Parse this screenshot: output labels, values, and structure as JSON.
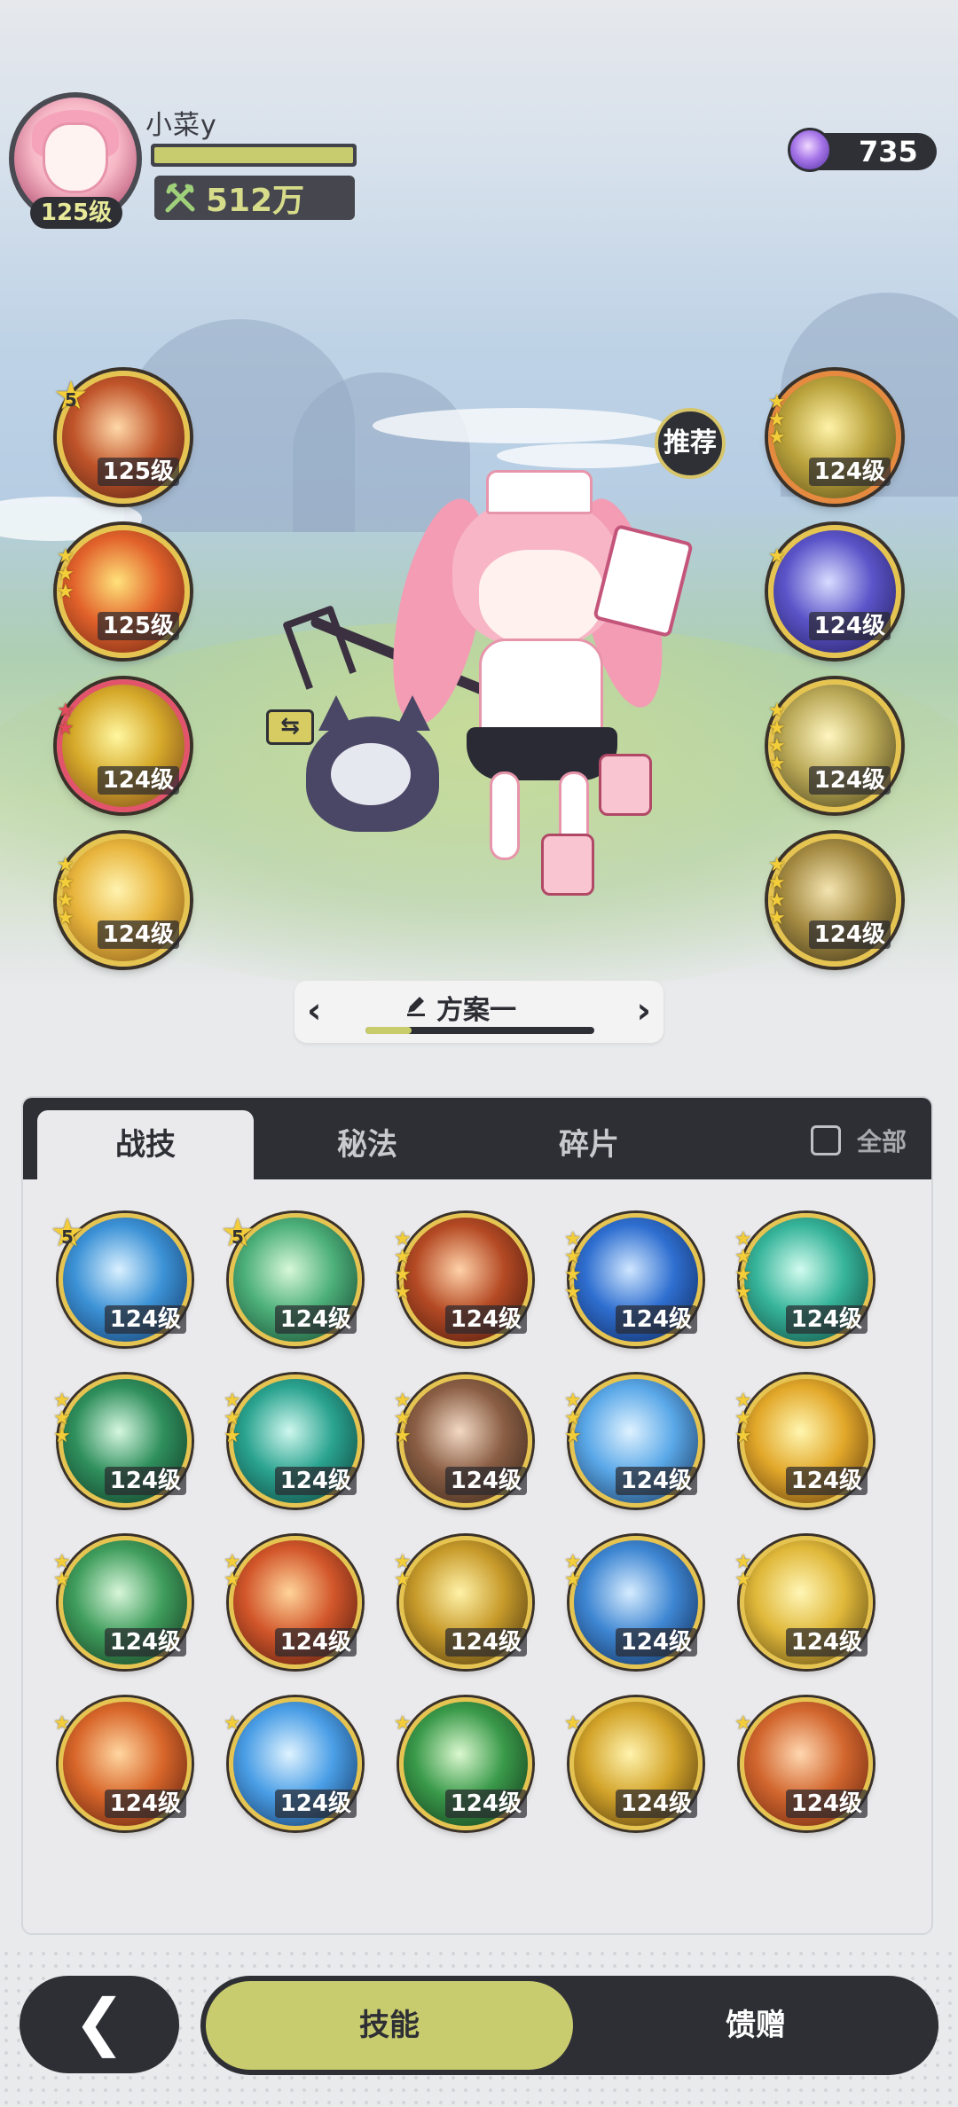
{
  "player": {
    "name": "小菜y",
    "level": "125级",
    "power": "512万",
    "exp_fraction": 1.0
  },
  "currency": {
    "icon": "purple-crystal-icon",
    "value": "735"
  },
  "recommend_label": "推荐",
  "left_slots": [
    {
      "level": "125级",
      "badge": "5",
      "stars": 0,
      "ring": "gold",
      "colors": [
        "#ffd8a8",
        "#c0542a",
        "#4a1d12"
      ]
    },
    {
      "level": "125级",
      "stars": 3,
      "ring": "gold",
      "colors": [
        "#ffe27a",
        "#e2622b",
        "#5e1e12"
      ]
    },
    {
      "level": "124级",
      "stars": 2,
      "star_color": "red",
      "ring": "red",
      "colors": [
        "#fff7a0",
        "#d6a92a",
        "#6b3a1a"
      ]
    },
    {
      "level": "124级",
      "stars": 4,
      "ring": "gold",
      "colors": [
        "#fff3b0",
        "#e8b53d",
        "#7a4f16"
      ]
    }
  ],
  "right_slots": [
    {
      "level": "124级",
      "stars": 3,
      "ring": "orange",
      "colors": [
        "#fff3a8",
        "#b9a23c",
        "#4f4416"
      ]
    },
    {
      "level": "124级",
      "stars": 1,
      "ring": "gold",
      "colors": [
        "#d8dcff",
        "#5b54c9",
        "#1d1850"
      ]
    },
    {
      "level": "124级",
      "stars": 4,
      "ring": "gold",
      "colors": [
        "#fff6c0",
        "#b9a857",
        "#3d3614"
      ]
    },
    {
      "level": "124级",
      "stars": 4,
      "ring": "gold",
      "colors": [
        "#f3e4b0",
        "#a48a42",
        "#2f2814"
      ]
    }
  ],
  "swap_label": "⇆",
  "preset": {
    "title": "方案一",
    "progress": 0.2
  },
  "panel": {
    "tabs": [
      "战技",
      "秘法",
      "碎片"
    ],
    "active_tab": 0,
    "check_all_label": "全部"
  },
  "skills": [
    {
      "level": "124级",
      "badge": "5",
      "stars": 0,
      "colors": [
        "#d9f0ff",
        "#3c92d6",
        "#0f2f5a"
      ]
    },
    {
      "level": "124级",
      "badge": "5",
      "stars": 0,
      "colors": [
        "#d7f7d9",
        "#4db07a",
        "#0f3a26"
      ]
    },
    {
      "level": "124级",
      "stars": 4,
      "colors": [
        "#ffd1a8",
        "#b44a24",
        "#3a120c"
      ]
    },
    {
      "level": "124级",
      "stars": 4,
      "colors": [
        "#cfe6ff",
        "#2f6fd0",
        "#0b1f4e"
      ]
    },
    {
      "level": "124级",
      "stars": 4,
      "colors": [
        "#d2fbee",
        "#36b49a",
        "#0c3b33"
      ]
    },
    {
      "level": "124级",
      "stars": 3,
      "colors": [
        "#d6f7e0",
        "#2f8f5c",
        "#0c2d1f"
      ]
    },
    {
      "level": "124级",
      "stars": 3,
      "colors": [
        "#cff7ee",
        "#2aa38f",
        "#0a3430"
      ]
    },
    {
      "level": "124级",
      "stars": 3,
      "colors": [
        "#f3d9c4",
        "#8a5e44",
        "#2f1f16"
      ]
    },
    {
      "level": "124级",
      "stars": 3,
      "colors": [
        "#dff2ff",
        "#5aa8e8",
        "#10284a"
      ]
    },
    {
      "level": "124级",
      "stars": 3,
      "colors": [
        "#fff6b0",
        "#e2a82a",
        "#4f2c0c"
      ]
    },
    {
      "level": "124级",
      "stars": 2,
      "colors": [
        "#d8f6da",
        "#3f9d5c",
        "#0f2c19"
      ]
    },
    {
      "level": "124级",
      "stars": 2,
      "colors": [
        "#ffd49a",
        "#d2562a",
        "#3e120c"
      ]
    },
    {
      "level": "124级",
      "stars": 2,
      "colors": [
        "#fff2a8",
        "#c79a2a",
        "#3a2a0c"
      ]
    },
    {
      "level": "124级",
      "stars": 2,
      "colors": [
        "#d6ecff",
        "#3e86d2",
        "#0c2146"
      ]
    },
    {
      "level": "124级",
      "stars": 2,
      "colors": [
        "#fff6b6",
        "#e0b83a",
        "#4a380e"
      ]
    },
    {
      "level": "124级",
      "stars": 1,
      "colors": [
        "#ffd6a0",
        "#d8662a",
        "#4a160c"
      ]
    },
    {
      "level": "124级",
      "stars": 1,
      "colors": [
        "#dff3ff",
        "#4a9ee6",
        "#0e2a52"
      ]
    },
    {
      "level": "124级",
      "stars": 1,
      "colors": [
        "#dbf8cf",
        "#3a9a4a",
        "#0d2a14"
      ]
    },
    {
      "level": "124级",
      "stars": 1,
      "colors": [
        "#fff3ae",
        "#d3a42a",
        "#3f2a0b"
      ]
    },
    {
      "level": "124级",
      "stars": 1,
      "colors": [
        "#ffd7b0",
        "#d2662e",
        "#5a1c0c"
      ]
    }
  ],
  "bottom_nav": {
    "back_label": "❮",
    "items": [
      "技能",
      "馈赠"
    ],
    "active": 0
  }
}
